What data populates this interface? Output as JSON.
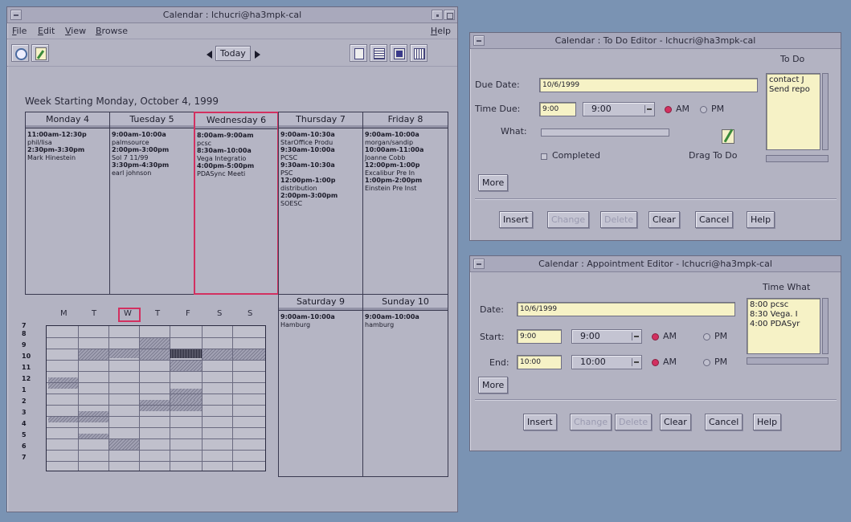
{
  "main_window": {
    "title": "Calendar : lchucri@ha3mpk-cal",
    "menu": {
      "file": "File",
      "edit": "Edit",
      "view": "View",
      "browse": "Browse",
      "help": "Help"
    },
    "toolbar": {
      "today": "Today"
    },
    "week_label": "Week Starting Monday, October  4, 1999",
    "days": [
      {
        "header": "Monday 4",
        "appts": [
          {
            "t": "11:00am-12:30p",
            "b": true
          },
          {
            "t": "phil/lisa",
            "b": false
          },
          {
            "t": "2:30pm-3:30pm",
            "b": true
          },
          {
            "t": "Mark Hinestein",
            "b": false
          }
        ]
      },
      {
        "header": "Tuesday 5",
        "appts": [
          {
            "t": "9:00am-10:00a",
            "b": true
          },
          {
            "t": "palmsource",
            "b": false
          },
          {
            "t": "2:00pm-3:00pm",
            "b": true
          },
          {
            "t": "Sol 7 11/99",
            "b": false
          },
          {
            "t": "3:30pm-4:30pm",
            "b": true
          },
          {
            "t": "earl johnson",
            "b": false
          }
        ]
      },
      {
        "header": "Wednesday 6",
        "appts": [
          {
            "t": "8:00am-9:00am",
            "b": true
          },
          {
            "t": "pcsc",
            "b": false
          },
          {
            "t": "8:30am-10:00a",
            "b": true
          },
          {
            "t": "Vega Integratio",
            "b": false
          },
          {
            "t": "4:00pm-5:00pm",
            "b": true
          },
          {
            "t": "PDASync Meeti",
            "b": false
          }
        ]
      },
      {
        "header": "Thursday 7",
        "appts": [
          {
            "t": "9:00am-10:30a",
            "b": true
          },
          {
            "t": "StarOffice Produ",
            "b": false
          },
          {
            "t": "9:30am-10:00a",
            "b": true
          },
          {
            "t": "PCSC",
            "b": false
          },
          {
            "t": "9:30am-10:30a",
            "b": true
          },
          {
            "t": "PSC",
            "b": false
          },
          {
            "t": "12:00pm-1:00p",
            "b": true
          },
          {
            "t": "distribution",
            "b": false
          },
          {
            "t": "2:00pm-3:00pm",
            "b": true
          },
          {
            "t": "SOESC",
            "b": false
          }
        ]
      },
      {
        "header": "Friday 8",
        "appts": [
          {
            "t": "9:00am-10:00a",
            "b": true
          },
          {
            "t": "morgan/sandip",
            "b": false
          },
          {
            "t": "10:00am-11:00a",
            "b": true
          },
          {
            "t": "Joanne Cobb",
            "b": false
          },
          {
            "t": "12:00pm-1:00p",
            "b": true
          },
          {
            "t": "Excalibur Pre In",
            "b": false
          },
          {
            "t": "1:00pm-2:00pm",
            "b": true
          },
          {
            "t": "Einstein Pre Inst",
            "b": false
          }
        ]
      },
      {
        "header": "Saturday 9",
        "appts": [
          {
            "t": "9:00am-10:00a",
            "b": true
          },
          {
            "t": "Hamburg",
            "b": false
          }
        ]
      },
      {
        "header": "Sunday 10",
        "appts": [
          {
            "t": "9:00am-10:00a",
            "b": true
          },
          {
            "t": "hamburg",
            "b": false
          }
        ]
      }
    ],
    "grid": {
      "day_letters": [
        "M",
        "T",
        "W",
        "T",
        "F",
        "S",
        "S"
      ],
      "hours": [
        "7",
        "8",
        "9",
        "10",
        "11",
        "12",
        "1",
        "2",
        "3",
        "4",
        "5",
        "6",
        "7"
      ]
    }
  },
  "todo_editor": {
    "title": "Calendar : To Do Editor - lchucri@ha3mpk-cal",
    "due_date_label": "Due Date:",
    "due_date": "10/6/1999",
    "time_due_label": "Time Due:",
    "time_due": "9:00",
    "time_combo": "9:00",
    "am": "AM",
    "pm": "PM",
    "what_label": "What:",
    "completed_label": "Completed",
    "drag_label": "Drag To Do",
    "more": "More",
    "list_title": "To Do",
    "list_items": [
      "contact J",
      "Send repo"
    ],
    "buttons": {
      "insert": "Insert",
      "change": "Change",
      "delete": "Delete",
      "clear": "Clear",
      "cancel": "Cancel",
      "help": "Help"
    }
  },
  "appt_editor": {
    "title": "Calendar : Appointment Editor - lchucri@ha3mpk-cal",
    "date_label": "Date:",
    "date": "10/6/1999",
    "start_label": "Start:",
    "start": "9:00",
    "start_combo": "9:00",
    "end_label": "End:",
    "end": "10:00",
    "end_combo": "10:00",
    "am": "AM",
    "pm": "PM",
    "more": "More",
    "list_header": "Time  What",
    "list_items": [
      "8:00 pcsc",
      "8:30 Vega. I",
      "4:00 PDASyr"
    ],
    "buttons": {
      "insert": "Insert",
      "change": "Change",
      "delete": "Delete",
      "clear": "Clear",
      "cancel": "Cancel",
      "help": "Help"
    }
  },
  "colors": {
    "desktop": "#7a93b3",
    "window": "#b3b3c2",
    "highlight": "#d23060",
    "field": "#f6f2c6"
  }
}
